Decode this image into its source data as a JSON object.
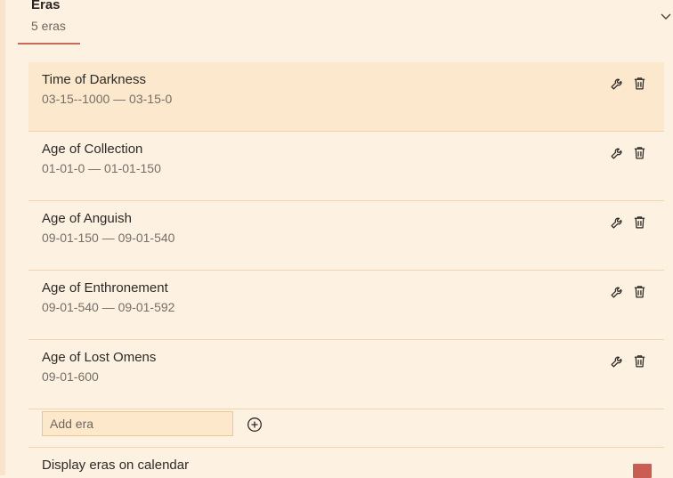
{
  "header": {
    "title": "Eras",
    "subtitle": "5 eras",
    "collapse_icon": "chevron-down-icon"
  },
  "eras": [
    {
      "name": "Time of Darkness",
      "range": "03-15--1000 — 03-15-0"
    },
    {
      "name": "Age of Collection",
      "range": "01-01-0 — 01-01-150"
    },
    {
      "name": "Age of Anguish",
      "range": "09-01-150 — 09-01-540"
    },
    {
      "name": "Age of Enthronement",
      "range": "09-01-540 — 09-01-592"
    },
    {
      "name": "Age of Lost Omens",
      "range": "09-01-600"
    }
  ],
  "add_era": {
    "placeholder": "Add era",
    "button_icon": "plus-circle-icon"
  },
  "display_setting": {
    "label": "Display eras on calendar"
  },
  "colors": {
    "background": "#fdf2e2",
    "active_row": "#fbe8cd",
    "accent": "#c96a5b",
    "divider": "#f1d3ac"
  }
}
